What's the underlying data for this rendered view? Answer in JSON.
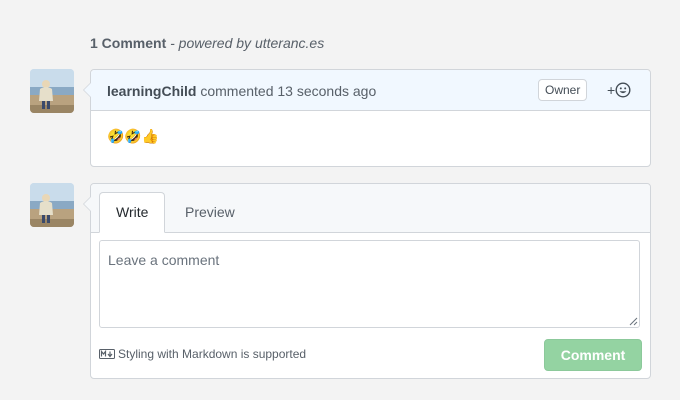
{
  "header": {
    "count": "1 Comment",
    "powered_prefix": " - powered by ",
    "powered_link": "utteranc.es"
  },
  "comments": [
    {
      "author": "learningChild",
      "action": "commented",
      "time": "13 seconds ago",
      "badge": "Owner",
      "reaction_plus": "+",
      "body": "🤣🤣👍",
      "avatar_icon": "user-avatar-photo"
    }
  ],
  "new_comment": {
    "tabs": [
      "Write",
      "Preview"
    ],
    "active_tab": "Write",
    "placeholder": "Leave a comment",
    "value": "",
    "markdown_note": "Styling with Markdown is supported",
    "submit_label": "Comment",
    "avatar_icon": "user-avatar-photo"
  },
  "colors": {
    "page_bg": "#f3f3f3",
    "comment_header_bg": "#f1f8ff",
    "submit_disabled_bg": "#94d3a2",
    "border": "#d1d5da"
  }
}
